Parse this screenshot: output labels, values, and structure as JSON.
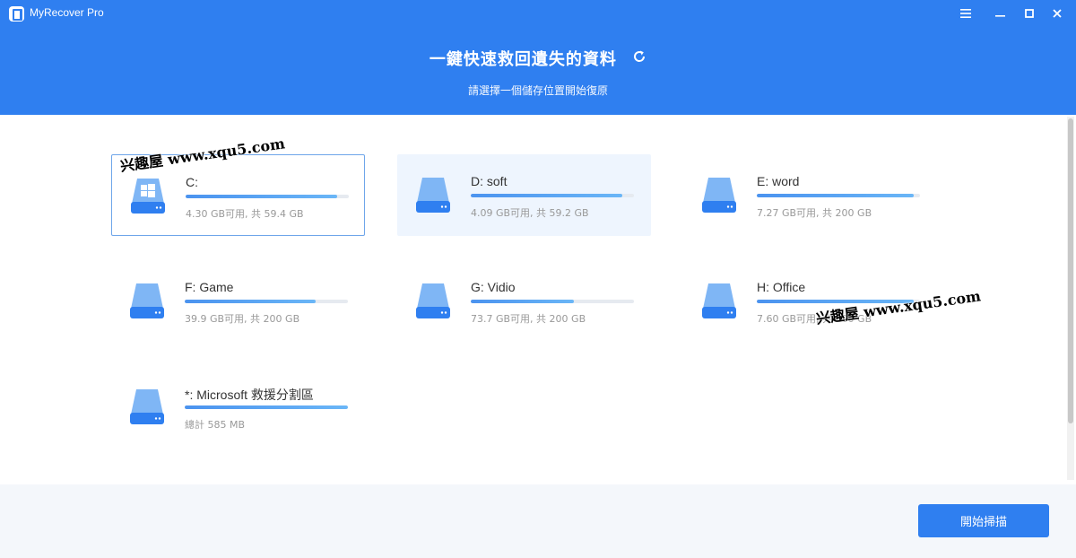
{
  "app": {
    "title": "MyRecover Pro"
  },
  "header": {
    "title": "一鍵快速救回遺失的資料",
    "subtitle": "請選擇一個儲存位置開始復原"
  },
  "drives": [
    {
      "name": "C:",
      "info": "4.30 GB可用, 共 59.4 GB",
      "used_fraction": 0.93,
      "icon": "windows-drive-icon",
      "state": "selected"
    },
    {
      "name": "D: soft",
      "info": "4.09 GB可用, 共 59.2 GB",
      "used_fraction": 0.93,
      "icon": "drive-icon",
      "state": "hover"
    },
    {
      "name": "E: word",
      "info": "7.27 GB可用, 共 200 GB",
      "used_fraction": 0.96,
      "icon": "drive-icon",
      "state": "normal"
    },
    {
      "name": "F: Game",
      "info": "39.9 GB可用, 共 200 GB",
      "used_fraction": 0.8,
      "icon": "drive-icon",
      "state": "normal"
    },
    {
      "name": "G: Vidio",
      "info": "73.7 GB可用, 共 200 GB",
      "used_fraction": 0.63,
      "icon": "drive-icon",
      "state": "normal"
    },
    {
      "name": "H: Office",
      "info": "7.60 GB可用, 共 200 GB",
      "used_fraction": 0.96,
      "icon": "drive-icon",
      "state": "normal"
    },
    {
      "name": "*: Microsoft 救援分割區",
      "info": "總計 585 MB",
      "used_fraction": 1.0,
      "icon": "drive-icon",
      "state": "normal"
    }
  ],
  "watermarks": [
    "兴趣屋 www.xqu5.com",
    "兴趣屋 www.xqu5.com"
  ],
  "footer": {
    "scan_label": "開始掃描"
  },
  "colors": {
    "accent": "#2f7ff0",
    "bar": "#4b93ef",
    "selected_border": "#6fa6ea"
  }
}
